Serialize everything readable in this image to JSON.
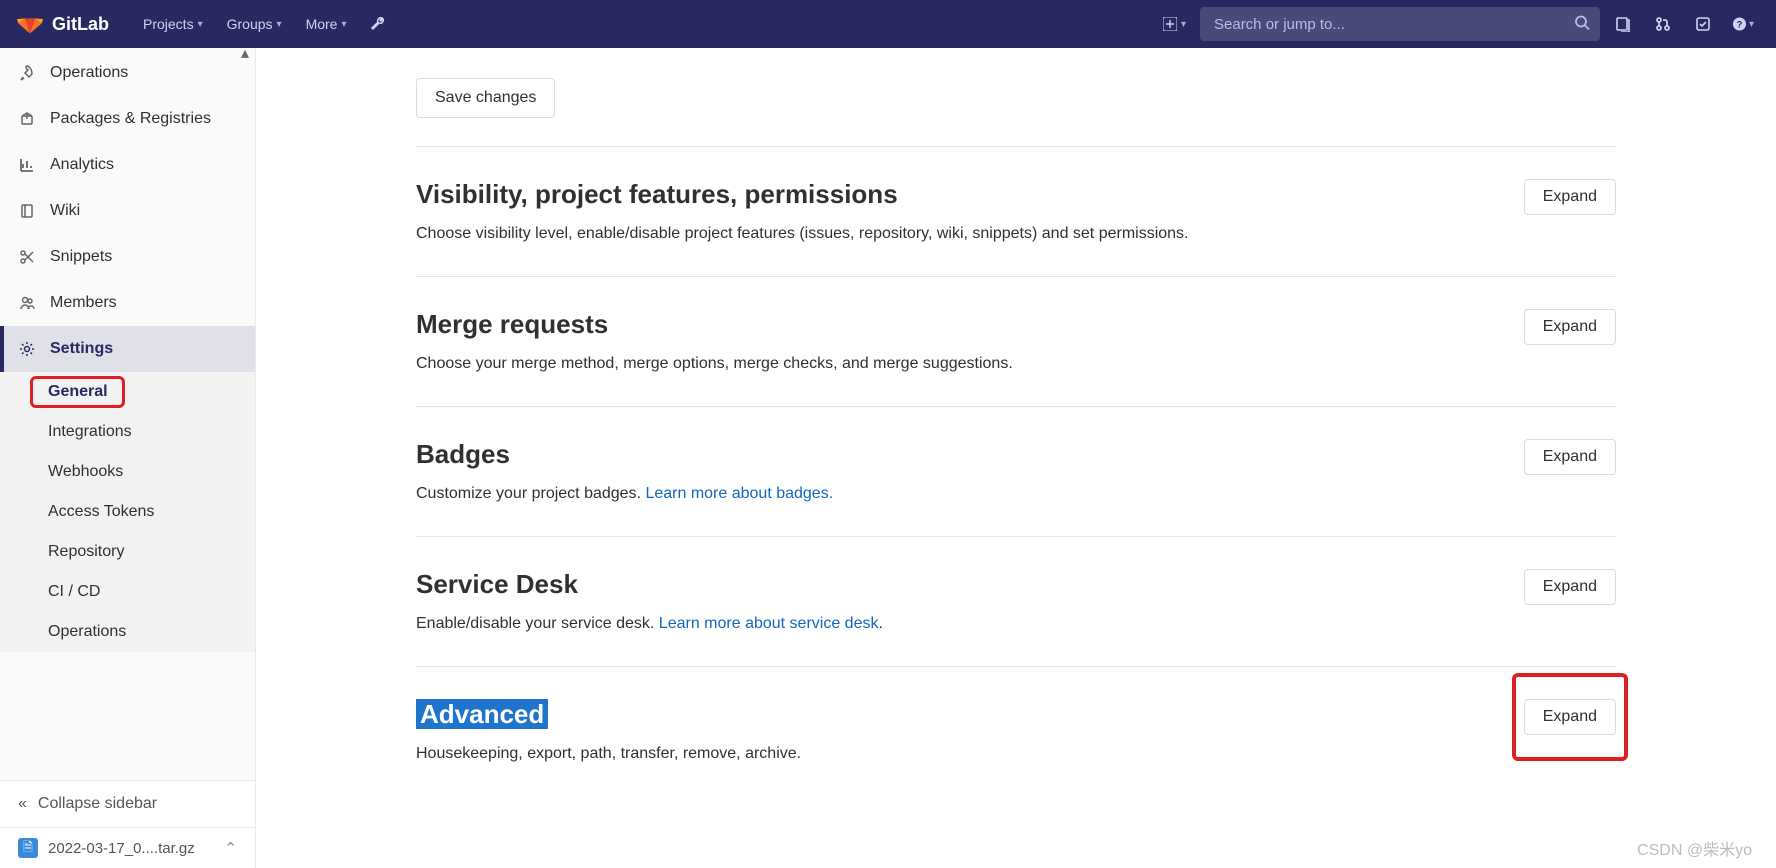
{
  "nav": {
    "brand": "GitLab",
    "items": [
      "Projects",
      "Groups",
      "More"
    ],
    "search_placeholder": "Search or jump to..."
  },
  "sidebar": {
    "items": [
      {
        "id": "operations",
        "label": "Operations",
        "icon": "rocket"
      },
      {
        "id": "packages-registries",
        "label": "Packages & Registries",
        "icon": "package"
      },
      {
        "id": "analytics",
        "label": "Analytics",
        "icon": "chart"
      },
      {
        "id": "wiki",
        "label": "Wiki",
        "icon": "book"
      },
      {
        "id": "snippets",
        "label": "Snippets",
        "icon": "scissors"
      },
      {
        "id": "members",
        "label": "Members",
        "icon": "users"
      },
      {
        "id": "settings",
        "label": "Settings",
        "icon": "gear",
        "active": true
      }
    ],
    "subitems": [
      {
        "id": "general",
        "label": "General",
        "active": true,
        "highlighted": true
      },
      {
        "id": "integrations",
        "label": "Integrations"
      },
      {
        "id": "webhooks",
        "label": "Webhooks"
      },
      {
        "id": "access-tokens",
        "label": "Access Tokens"
      },
      {
        "id": "repository",
        "label": "Repository"
      },
      {
        "id": "ci-cd",
        "label": "CI / CD"
      },
      {
        "id": "sub-operations",
        "label": "Operations"
      }
    ],
    "collapse_label": "Collapse sidebar",
    "download_item": "2022-03-17_0....tar.gz"
  },
  "main": {
    "save_label": "Save changes",
    "expand_label": "Expand",
    "sections": [
      {
        "id": "visibility",
        "title": "Visibility, project features, permissions",
        "desc": "Choose visibility level, enable/disable project features (issues, repository, wiki, snippets) and set permissions."
      },
      {
        "id": "merge-requests",
        "title": "Merge requests",
        "desc": "Choose your merge method, merge options, merge checks, and merge suggestions."
      },
      {
        "id": "badges",
        "title": "Badges",
        "desc_pre": "Customize your project badges. ",
        "link": "Learn more about badges.",
        "desc_post": ""
      },
      {
        "id": "service-desk",
        "title": "Service Desk",
        "desc_pre": "Enable/disable your service desk. ",
        "link": "Learn more about service desk",
        "desc_post": "."
      },
      {
        "id": "advanced",
        "title": "Advanced",
        "desc": "Housekeeping, export, path, transfer, remove, archive.",
        "highlighted": true
      }
    ]
  },
  "watermark": "CSDN @柴米yo"
}
